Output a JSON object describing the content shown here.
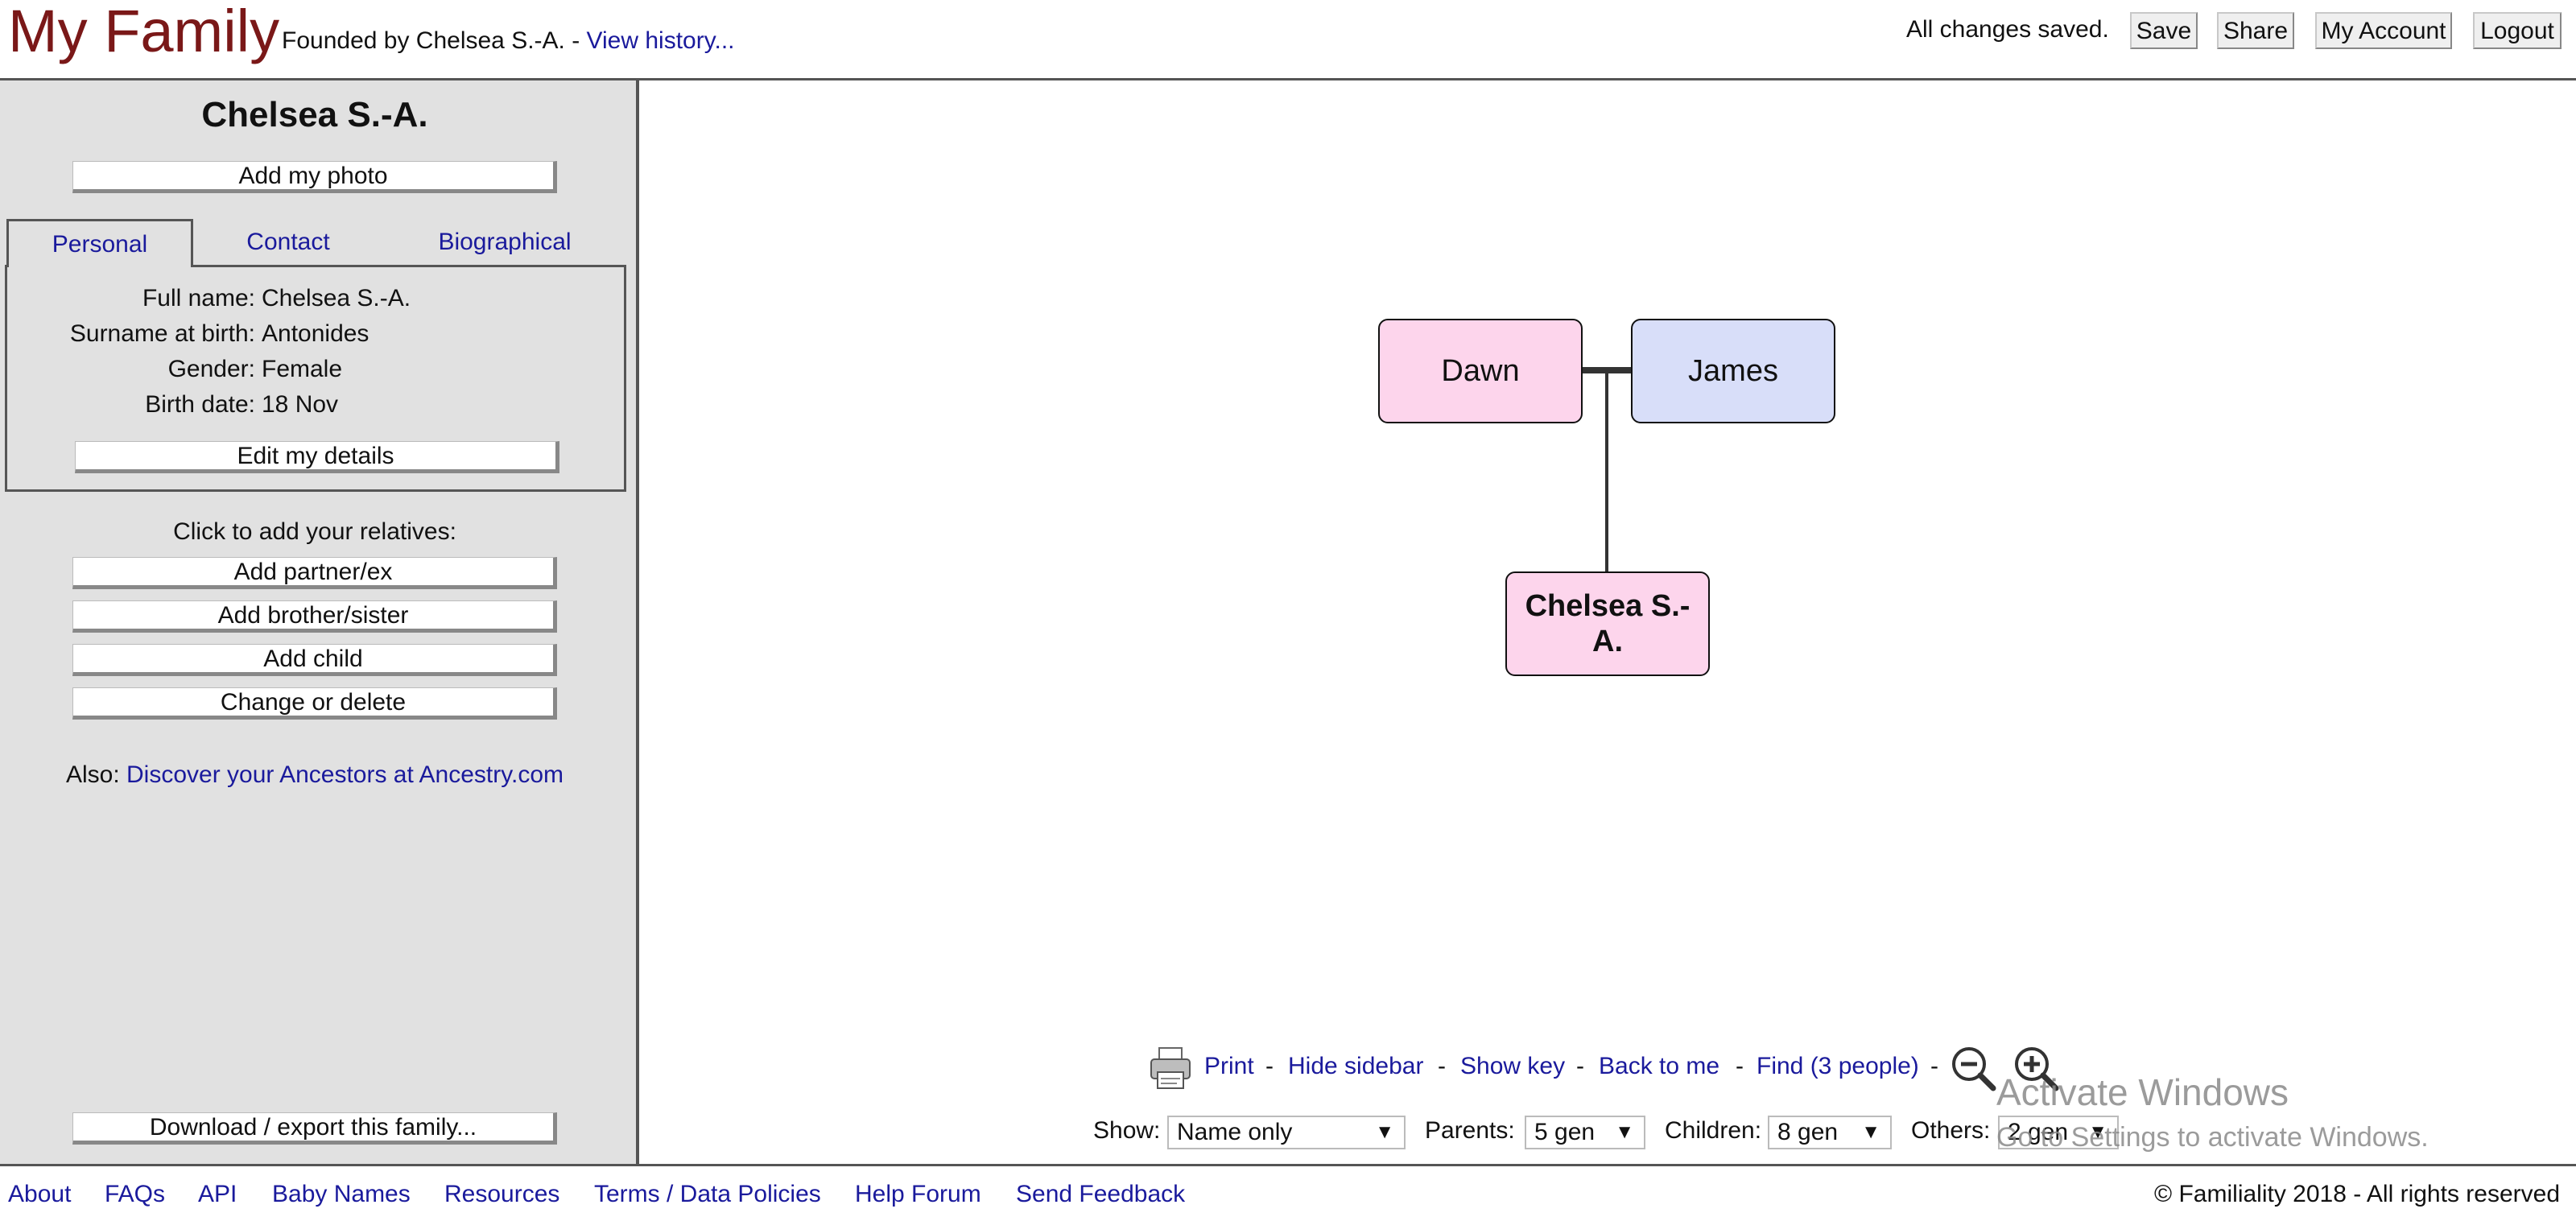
{
  "header": {
    "title": "My Family",
    "founded_text": "Founded by Chelsea S.-A. - ",
    "history_link": "View history...",
    "status": "All changes saved.",
    "buttons": {
      "save": "Save",
      "share": "Share",
      "account": "My Account",
      "logout": "Logout"
    }
  },
  "sidebar": {
    "name": "Chelsea S.-A.",
    "add_photo": "Add my photo",
    "tabs": [
      {
        "label": "Personal",
        "active": true
      },
      {
        "label": "Contact"
      },
      {
        "label": "Biographical"
      }
    ],
    "details": [
      {
        "label": "Full name:",
        "value": "Chelsea S.-A."
      },
      {
        "label": "Surname at birth:",
        "value": "Antonides"
      },
      {
        "label": "Gender:",
        "value": "Female"
      },
      {
        "label": "Birth date:",
        "value": "18 Nov"
      }
    ],
    "edit_button": "Edit my details",
    "relatives_label": "Click to add your relatives:",
    "relative_buttons": {
      "partner": "Add partner/ex",
      "sibling": "Add brother/sister",
      "child": "Add child",
      "change": "Change or delete"
    },
    "also_prefix": "Also: ",
    "also_link": "Discover your Ancestors at Ancestry.com",
    "download_button": "Download / export this family..."
  },
  "tree": {
    "people": [
      {
        "name": "Dawn",
        "gender": "female",
        "color": "#fdd5ec"
      },
      {
        "name": "James",
        "gender": "male",
        "color": "#d8def9"
      },
      {
        "name": "Chelsea S.-A.",
        "name_line1": "Chelsea S.-",
        "name_line2": "A.",
        "gender": "female",
        "color": "#fdd5ec",
        "is_me": true
      }
    ]
  },
  "toolbar": {
    "print": "Print",
    "hide_sidebar": "Hide sidebar",
    "show_key": "Show key",
    "back_to_me": "Back to me",
    "find": "Find (3 people)",
    "separator": "-",
    "zoom_out_icon": "zoom-out-icon",
    "zoom_in_icon": "zoom-in-icon",
    "print_icon": "printer-icon"
  },
  "controls": {
    "show_label": "Show:",
    "show_value": "Name only",
    "parents_label": "Parents:",
    "parents_value": "5 gen",
    "children_label": "Children:",
    "children_value": "8 gen",
    "others_label": "Others:",
    "others_value": "2 gen",
    "arrow": "▼"
  },
  "watermark": {
    "line1": "Activate Windows",
    "line2": "Go to Settings to activate Windows."
  },
  "footer": {
    "links": [
      "About",
      "FAQs",
      "API",
      "Baby Names",
      "Resources",
      "Terms / Data Policies",
      "Help Forum",
      "Send Feedback"
    ],
    "copyright": "© Familiality 2018 - All rights reserved"
  },
  "colors": {
    "title": "#7a1818",
    "link": "#1a1a9c",
    "sidebar_bg": "#e1e1e1",
    "female": "#fdd5ec",
    "male": "#d8def9"
  }
}
